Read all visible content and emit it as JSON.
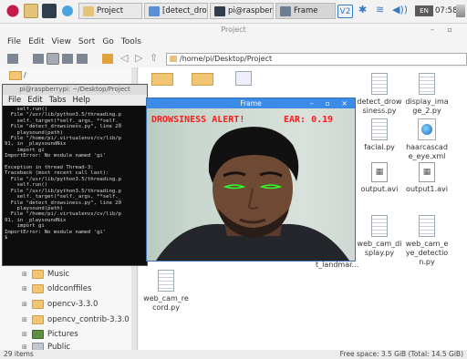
{
  "taskbar": {
    "windows": [
      {
        "label": "Project"
      },
      {
        "label": "[detect_drow..."
      },
      {
        "label": "pi@raspberry..."
      },
      {
        "label": "Frame"
      }
    ],
    "vnc_label": "V2",
    "keyboard_label": "EN",
    "clock": "07:58"
  },
  "file_manager": {
    "title": "Project",
    "menu": [
      "File",
      "Edit",
      "View",
      "Sort",
      "Go",
      "Tools"
    ],
    "path": "/home/pi/Desktop/Project",
    "sidebar": [
      "Music",
      "oldconffiles",
      "opencv-3.3.0",
      "opencv_contrib-3.3.0",
      "Pictures",
      "Public"
    ],
    "files": [
      {
        "name": "detect_drow siness.py"
      },
      {
        "name": "display_ima ge_2.py"
      },
      {
        "name": "facial.py"
      },
      {
        "name": "haarcascad e_eye.xml"
      },
      {
        "name": "output.avi"
      },
      {
        "name": "output1.avi"
      },
      {
        "name": "web_cam_di splay.py"
      },
      {
        "name": "web_cam_e ye_detectio n.py"
      },
      {
        "name": "web_cam_re cord.py"
      },
      {
        "name": "t_landmar..."
      }
    ],
    "status_left": "29 items",
    "status_right": "Free space: 3.5 GiB (Total: 14.5 GiB)"
  },
  "terminal": {
    "title": "pi@raspberrypi: ~/Desktop/Project",
    "menu": [
      "File",
      "Edit",
      "Tabs",
      "Help"
    ],
    "lines": [
      "    self.run()",
      "  File \"/usr/lib/python3.5/threading.p",
      "    self._target(*self._args, **self._",
      "  File \"detect_drowsiness.py\", line 20",
      "    playsound(path)",
      "  File \"/home/pi/.virtualenvs/cv/lib/p",
      "91, in _playsoundNix",
      "    import gi",
      "ImportError: No module named 'gi'",
      "",
      "Exception in thread Thread-3:",
      "Traceback (most recent call last):",
      "  File \"/usr/lib/python3.5/threading.p",
      "    self.run()",
      "  File \"/usr/lib/python3.5/threading.p",
      "    self._target(*self._args, **self._",
      "  File \"detect_drowsiness.py\", line 20",
      "    playsound(path)",
      "  File \"/home/pi/.virtualenvs/cv/lib/p",
      "91, in _playsoundNix",
      "    import gi",
      "ImportError: No module named 'gi'",
      "$"
    ]
  },
  "frame_window": {
    "title": "Frame",
    "controls": "– ▫ ×",
    "alert_text": "DROWSINESS ALERT!",
    "ear_text": "EAR: 0.19",
    "alert_color": "#ff1a1a"
  }
}
